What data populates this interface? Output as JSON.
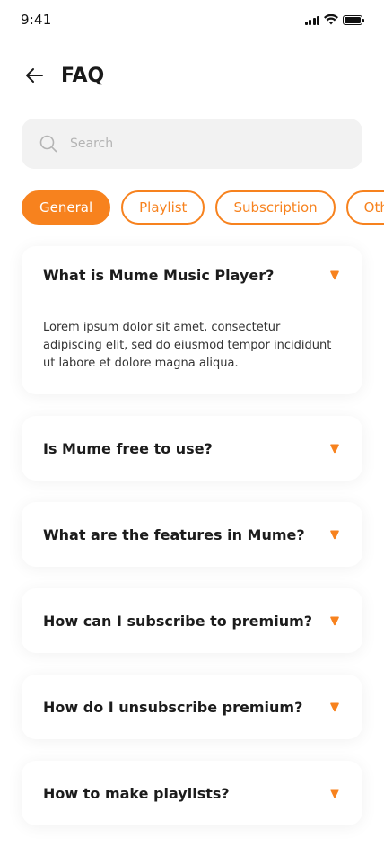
{
  "status": {
    "time": "9:41"
  },
  "header": {
    "title": "FAQ"
  },
  "search": {
    "placeholder": "Search"
  },
  "categories": [
    {
      "label": "General",
      "active": true
    },
    {
      "label": "Playlist",
      "active": false
    },
    {
      "label": "Subscription",
      "active": false
    },
    {
      "label": "Others",
      "active": false
    }
  ],
  "faqs": [
    {
      "question": "What is Mume Music Player?",
      "answer": "Lorem ipsum dolor sit amet, consectetur adipiscing elit, sed do eiusmod tempor incididunt ut labore et dolore magna aliqua.",
      "expanded": true
    },
    {
      "question": "Is Mume free to use?",
      "expanded": false
    },
    {
      "question": "What are the features in Mume?",
      "expanded": false
    },
    {
      "question": "How can I subscribe to premium?",
      "expanded": false
    },
    {
      "question": "How do I unsubscribe premium?",
      "expanded": false
    },
    {
      "question": "How to make playlists?",
      "expanded": false
    }
  ],
  "colors": {
    "accent": "#f7821e",
    "text": "#1c1c1c",
    "search_bg": "#f2f2f2"
  },
  "icons": {
    "back": "arrow-left-icon",
    "search": "search-icon",
    "expand": "caret-down-icon"
  }
}
